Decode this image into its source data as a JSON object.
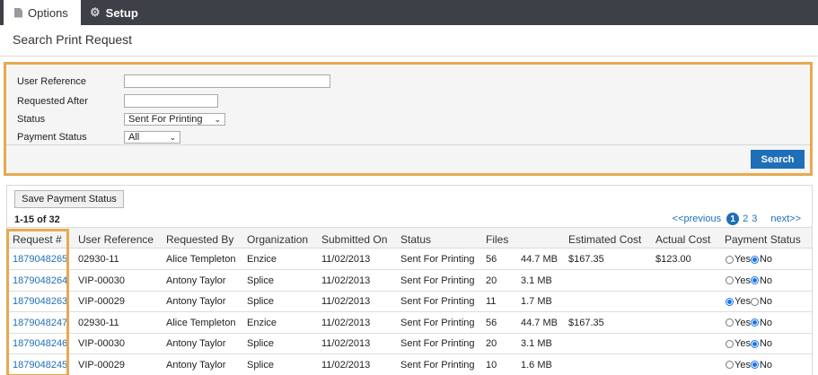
{
  "tabs": [
    {
      "label": "Options",
      "icon": "document-icon",
      "active": true
    },
    {
      "label": "Setup",
      "icon": "gear-icon",
      "active": false
    }
  ],
  "page_title": "Search Print Request",
  "search_form": {
    "user_reference": {
      "label": "User Reference",
      "value": ""
    },
    "requested_after": {
      "label": "Requested After",
      "value": ""
    },
    "status": {
      "label": "Status",
      "value": "Sent For Printing"
    },
    "payment_status": {
      "label": "Payment Status",
      "value": "All"
    },
    "search_button": "Search"
  },
  "results": {
    "save_button": "Save Payment Status",
    "count": "1-15 of 32",
    "pager": {
      "previous": "<<previous",
      "current": "1",
      "pages": [
        "2",
        "3"
      ],
      "next": "next>>"
    },
    "columns": [
      "Request #",
      "User Reference",
      "Requested By",
      "Organization",
      "Submitted On",
      "Status",
      "Files",
      "Estimated Cost",
      "Actual Cost",
      "Payment Status"
    ],
    "radio_labels": {
      "yes": "Yes",
      "no": "No"
    },
    "rows": [
      {
        "request": "1879048265",
        "user_ref": "02930-11",
        "requested_by": "Alice Templeton",
        "organization": "Enzice",
        "submitted_on": "11/02/2013",
        "status": "Sent For Printing",
        "files": "56",
        "size": "44.7 MB",
        "estimated_cost": "$167.35",
        "actual_cost": "$123.00",
        "paid": false
      },
      {
        "request": "1879048264",
        "user_ref": "VIP-00030",
        "requested_by": "Antony Taylor",
        "organization": "Splice",
        "submitted_on": "11/02/2013",
        "status": "Sent For Printing",
        "files": "20",
        "size": "3.1 MB",
        "estimated_cost": "",
        "actual_cost": "",
        "paid": false
      },
      {
        "request": "1879048263",
        "user_ref": "VIP-00029",
        "requested_by": "Antony Taylor",
        "organization": "Splice",
        "submitted_on": "11/02/2013",
        "status": "Sent For Printing",
        "files": "11",
        "size": "1.7 MB",
        "estimated_cost": "",
        "actual_cost": "",
        "paid": true
      },
      {
        "request": "1879048247",
        "user_ref": "02930-11",
        "requested_by": "Alice Templeton",
        "organization": "Enzice",
        "submitted_on": "11/02/2013",
        "status": "Sent For Printing",
        "files": "56",
        "size": "44.7 MB",
        "estimated_cost": "$167.35",
        "actual_cost": "",
        "paid": false
      },
      {
        "request": "1879048246",
        "user_ref": "VIP-00030",
        "requested_by": "Antony Taylor",
        "organization": "Splice",
        "submitted_on": "11/02/2013",
        "status": "Sent For Printing",
        "files": "20",
        "size": "3.1 MB",
        "estimated_cost": "",
        "actual_cost": "",
        "paid": false
      },
      {
        "request": "1879048245",
        "user_ref": "VIP-00029",
        "requested_by": "Antony Taylor",
        "organization": "Splice",
        "submitted_on": "11/02/2013",
        "status": "Sent For Printing",
        "files": "10",
        "size": "1.6 MB",
        "estimated_cost": "",
        "actual_cost": "",
        "paid": false
      }
    ]
  },
  "colors": {
    "accent": "#1f6fb8",
    "highlight": "#e8a94f",
    "tabbar": "#3d4047"
  }
}
